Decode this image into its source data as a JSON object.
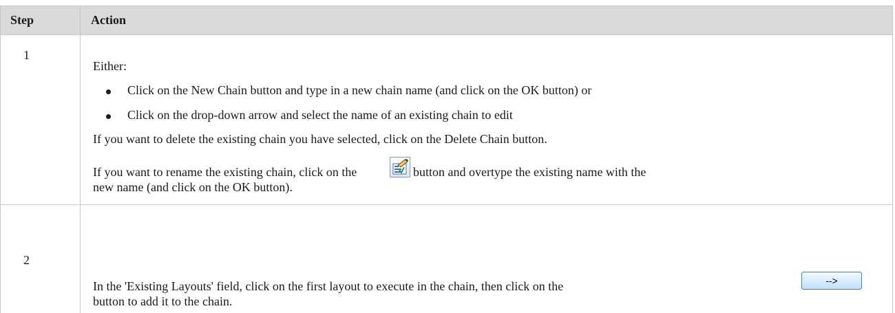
{
  "table": {
    "headers": {
      "step": "Step",
      "action": "Action"
    },
    "rows": [
      {
        "step": "1",
        "intro": "Either:",
        "bullets": [
          "Click on the New Chain button and type in a new chain name (and click on the OK button) or",
          "Click on the drop-down arrow and select the name of an existing chain to edit"
        ],
        "delete_text": "If you want to delete the existing chain you have selected, click on the Delete Chain button.",
        "rename_text_before": "If you want to rename the existing chain, click on the",
        "rename_text_after": "button and overtype the existing name with the",
        "rename_text_line2": "new name (and click on the OK button)."
      },
      {
        "step": "2",
        "line1_before": "In the 'Existing Layouts' field, click on the first layout to execute in the chain, then click on the",
        "button_label": "-->",
        "line2": "button to add it to the chain."
      }
    ]
  },
  "icons": {
    "rename": "rename-properties-icon"
  }
}
